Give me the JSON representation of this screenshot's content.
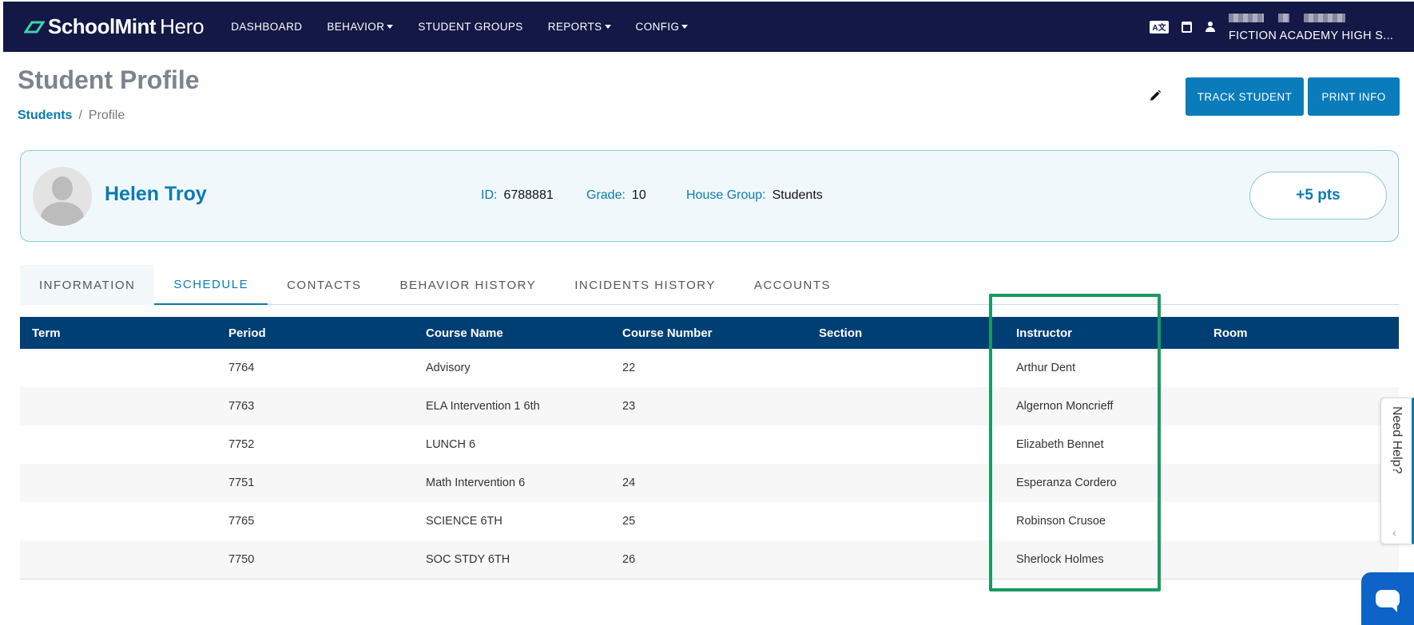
{
  "nav": {
    "logo_bold": "SchoolMint",
    "logo_light": "Hero",
    "items": [
      {
        "label": "DASHBOARD",
        "dropdown": false
      },
      {
        "label": "BEHAVIOR",
        "dropdown": true
      },
      {
        "label": "STUDENT GROUPS",
        "dropdown": false
      },
      {
        "label": "REPORTS",
        "dropdown": true
      },
      {
        "label": "CONFIG",
        "dropdown": true
      }
    ],
    "translate_icon": "translate-icon",
    "calendar_icon": "calendar-icon",
    "user_icon": "user-icon",
    "school_name": "FICTION ACADEMY HIGH S..."
  },
  "header": {
    "title": "Student Profile",
    "breadcrumb_link": "Students",
    "breadcrumb_sep": "/",
    "breadcrumb_current": "Profile",
    "track_label": "TRACK STUDENT",
    "print_label": "PRINT INFO"
  },
  "profile": {
    "name": "Helen Troy",
    "id_label": "ID:",
    "id_value": "6788881",
    "grade_label": "Grade:",
    "grade_value": "10",
    "house_label": "House Group:",
    "house_value": "Students",
    "points_label": "+5 pts"
  },
  "tabs": [
    "INFORMATION",
    "SCHEDULE",
    "CONTACTS",
    "BEHAVIOR HISTORY",
    "INCIDENTS HISTORY",
    "ACCOUNTS"
  ],
  "active_tab": "SCHEDULE",
  "table": {
    "headers": [
      "Term",
      "Period",
      "Course Name",
      "Course Number",
      "Section",
      "Instructor",
      "Room"
    ],
    "rows": [
      {
        "term": "",
        "period": "7764",
        "course": "Advisory",
        "number": "22",
        "section": "",
        "instructor": "Arthur Dent",
        "room": ""
      },
      {
        "term": "",
        "period": "7763",
        "course": "ELA Intervention 1 6th",
        "number": "23",
        "section": "",
        "instructor": "Algernon Moncrieff",
        "room": ""
      },
      {
        "term": "",
        "period": "7752",
        "course": "LUNCH 6",
        "number": "",
        "section": "",
        "instructor": "Elizabeth Bennet",
        "room": ""
      },
      {
        "term": "",
        "period": "7751",
        "course": "Math Intervention 6",
        "number": "24",
        "section": "",
        "instructor": "Esperanza Cordero",
        "room": ""
      },
      {
        "term": "",
        "period": "7765",
        "course": "SCIENCE 6TH",
        "number": "25",
        "section": "",
        "instructor": "Robinson Crusoe",
        "room": ""
      },
      {
        "term": "",
        "period": "7750",
        "course": "SOC STDY 6TH",
        "number": "26",
        "section": "",
        "instructor": "Sherlock Holmes",
        "room": ""
      }
    ]
  },
  "help": {
    "label": "Need Help?"
  },
  "colors": {
    "navbar": "#141846",
    "accent": "#0a7bb0",
    "table_header": "#003f74",
    "highlight": "#1a9a62",
    "chat": "#0d63c8"
  }
}
